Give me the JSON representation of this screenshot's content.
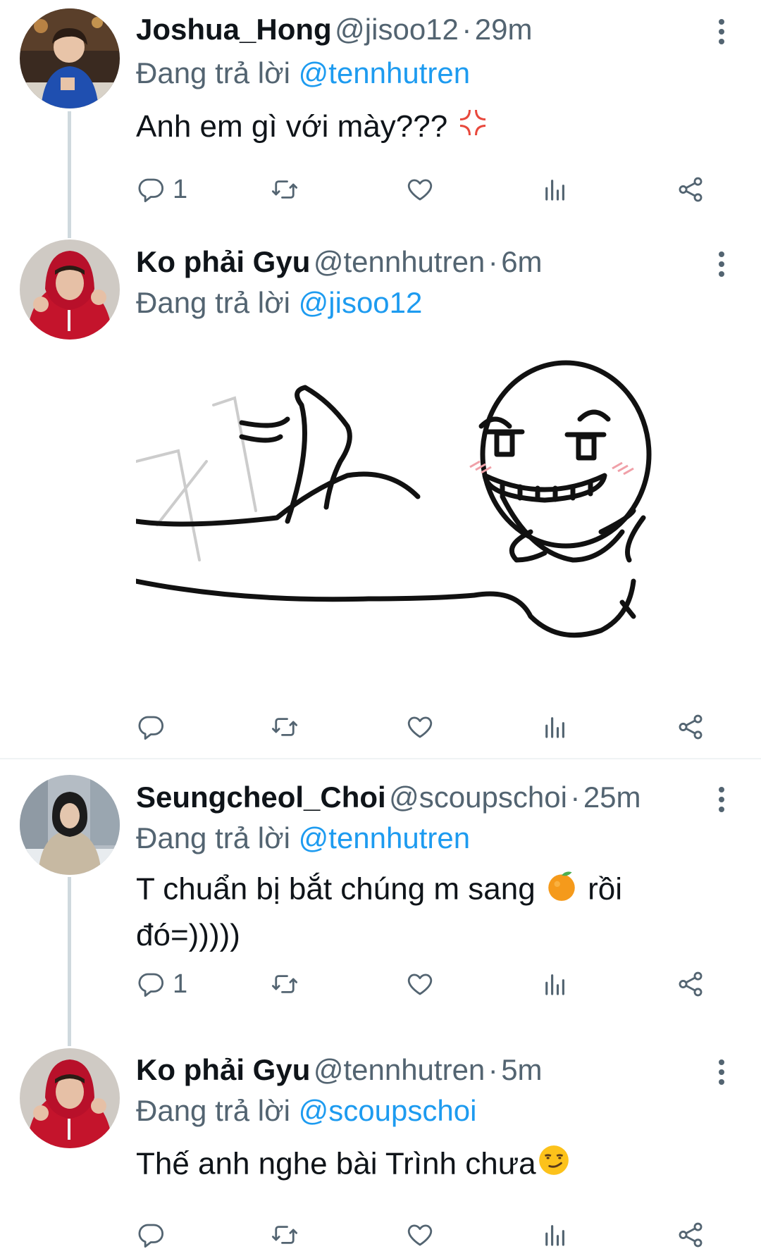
{
  "tweets": [
    {
      "name": "Joshua_Hong",
      "handle": "@jisoo12",
      "time": "29m",
      "reply_prefix": "Đang trả lời",
      "reply_to": "@tennhutren",
      "text": "Anh em gì với mày???",
      "emoji": "anger-symbol",
      "reply_count": "1"
    },
    {
      "name": "Ko phải Gyu",
      "handle": "@tennhutren",
      "time": "6m",
      "reply_prefix": "Đang trả lời",
      "reply_to": "@jisoo12",
      "media": "meme-drawing-lying-smirk",
      "reply_count": ""
    },
    {
      "name": "Seungcheol_Choi",
      "handle": "@scoupschoi",
      "time": "25m",
      "reply_prefix": "Đang trả lời",
      "reply_to": "@tennhutren",
      "text_part1": "T chuẩn bị bắt chúng m sang",
      "emoji": "tangerine",
      "text_part2": "rồi",
      "text_line2": "đó=)))))",
      "reply_count": "1"
    },
    {
      "name": "Ko phải Gyu",
      "handle": "@tennhutren",
      "time": "5m",
      "reply_prefix": "Đang trả lời",
      "reply_to": "@scoupschoi",
      "text": "Thế anh nghe bài Trình chưa",
      "emoji": "smirking-face",
      "reply_count": ""
    }
  ],
  "separator": "·",
  "colors": {
    "mention": "#1d9bf0",
    "secondary": "#536471",
    "text": "#0f1419",
    "thread_line": "#cfd9de"
  }
}
